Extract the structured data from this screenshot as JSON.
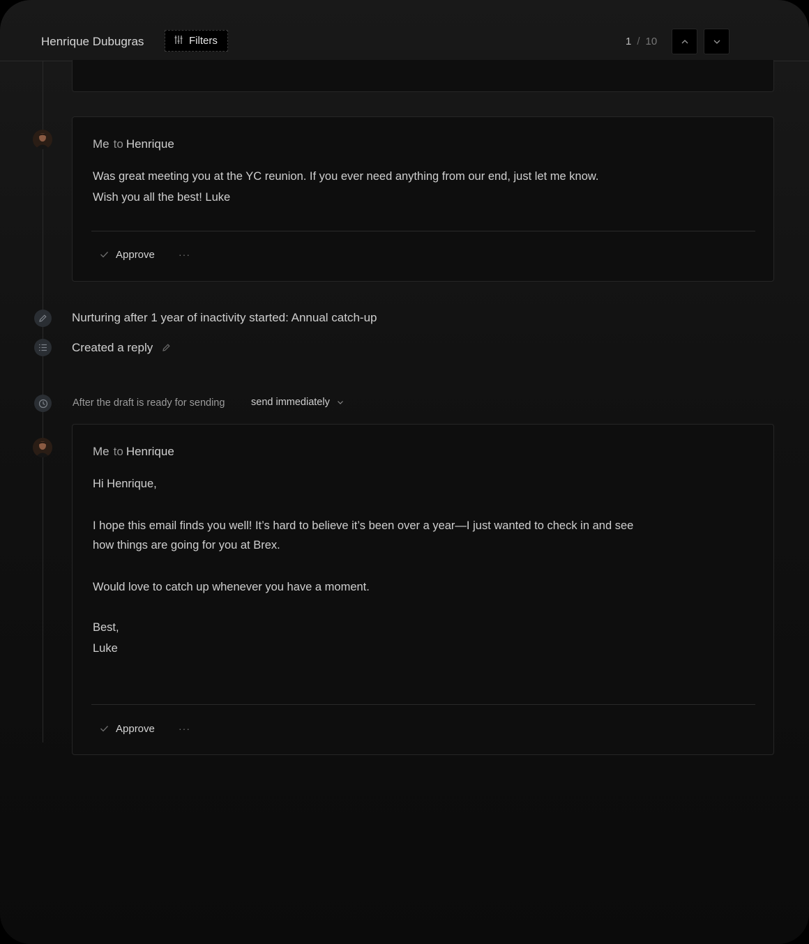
{
  "header": {
    "contact_name": "Henrique Dubugras",
    "filters_label": "Filters",
    "page_current": "1",
    "page_separator": "/",
    "page_total": "10"
  },
  "emails": [
    {
      "from": "Me",
      "to_label": "to",
      "recipient": "Henrique",
      "lines": [
        "Was great meeting you at the YC reunion. If you ever need anything from our end, just let me know.",
        "Wish you all the best! Luke"
      ],
      "approve_label": "Approve",
      "more_label": "···"
    },
    {
      "from": "Me",
      "to_label": "to",
      "recipient": "Henrique",
      "lines": [
        "Hi Henrique,",
        "I hope this email finds you well! It’s hard to believe it’s been over a year—I just wanted to check in and see",
        "how things are going for you at Brex.",
        "Would love to catch up whenever you have a moment.",
        "Best,",
        "Luke"
      ],
      "approve_label": "Approve",
      "more_label": "···"
    }
  ],
  "events": {
    "nurturing": "Nurturing after 1 year of inactivity started: Annual catch-up",
    "created_reply": "Created a reply"
  },
  "schedule": {
    "label": "After the draft is ready for sending",
    "value": "send immediately"
  }
}
